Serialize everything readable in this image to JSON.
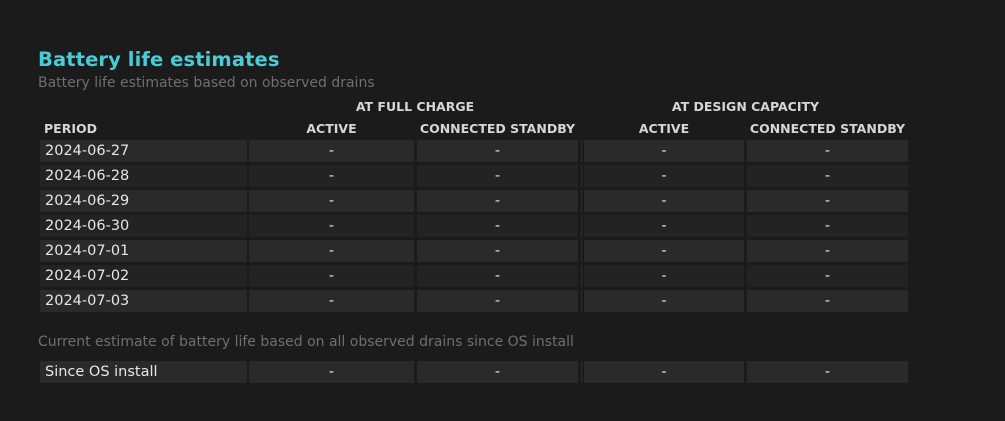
{
  "heading": {
    "title": "Battery life estimates",
    "subtitle": "Battery life estimates based on observed drains"
  },
  "table": {
    "groups": [
      "AT FULL CHARGE",
      "AT DESIGN CAPACITY"
    ],
    "columns": [
      "PERIOD",
      "ACTIVE",
      "CONNECTED STANDBY",
      "ACTIVE",
      "CONNECTED STANDBY"
    ],
    "rows": [
      [
        "2024-06-27",
        "-",
        "-",
        "-",
        "-"
      ],
      [
        "2024-06-28",
        "-",
        "-",
        "-",
        "-"
      ],
      [
        "2024-06-29",
        "-",
        "-",
        "-",
        "-"
      ],
      [
        "2024-06-30",
        "-",
        "-",
        "-",
        "-"
      ],
      [
        "2024-07-01",
        "-",
        "-",
        "-",
        "-"
      ],
      [
        "2024-07-02",
        "-",
        "-",
        "-",
        "-"
      ],
      [
        "2024-07-03",
        "-",
        "-",
        "-",
        "-"
      ]
    ]
  },
  "current": {
    "note": "Current estimate of battery life based on all observed drains since OS install",
    "row": [
      "Since OS install",
      "-",
      "-",
      "-",
      "-"
    ]
  }
}
